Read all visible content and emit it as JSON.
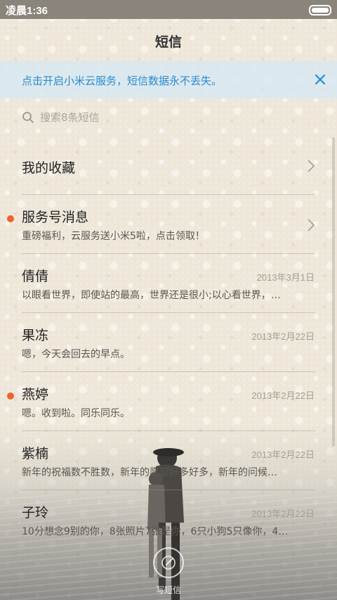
{
  "status_bar": {
    "time": "凌晨1:36"
  },
  "header": {
    "title": "短信"
  },
  "banner": {
    "text": "点击开启小米云服务，短信数据永不丢失。",
    "close_icon": "close-icon"
  },
  "search": {
    "placeholder": "搜索8条短信",
    "icon": "search-icon"
  },
  "favorites": {
    "label": "我的收藏",
    "icon": "chevron-right-icon"
  },
  "service": {
    "name": "服务号消息",
    "snippet": "重磅福利，云服务送小米5啦，点击领取！",
    "unread": true,
    "icon": "chevron-right-icon"
  },
  "conversations": [
    {
      "name": "倩倩",
      "date": "2013年3月1日",
      "snippet": "以眼看世界，即使站的最高，世界还是很小;以心看世界，…",
      "unread": false
    },
    {
      "name": "果冻",
      "date": "2013年2月22日",
      "snippet": "嗯，今天会回去的早点。",
      "unread": false
    },
    {
      "name": "燕婷",
      "date": "2013年2月22日",
      "snippet": "嗯。收到啦。同乐同乐。",
      "unread": true
    },
    {
      "name": "紫楠",
      "date": "2013年2月22日",
      "snippet": "新年的祝福数不胜数，新年的愿望好多好多，新年的问候…",
      "unread": false
    },
    {
      "name": "子玲",
      "date": "2013年2月22日",
      "snippet": "10分想念9别的你，8张照片7张是你，6只小狗5只像你，4…",
      "unread": false
    }
  ],
  "compose": {
    "label": "写短信",
    "icon": "compose-icon"
  },
  "colors": {
    "accent_blue": "#2a8bd2",
    "unread_dot": "#f2612a",
    "status_bar": "#8b847a"
  }
}
